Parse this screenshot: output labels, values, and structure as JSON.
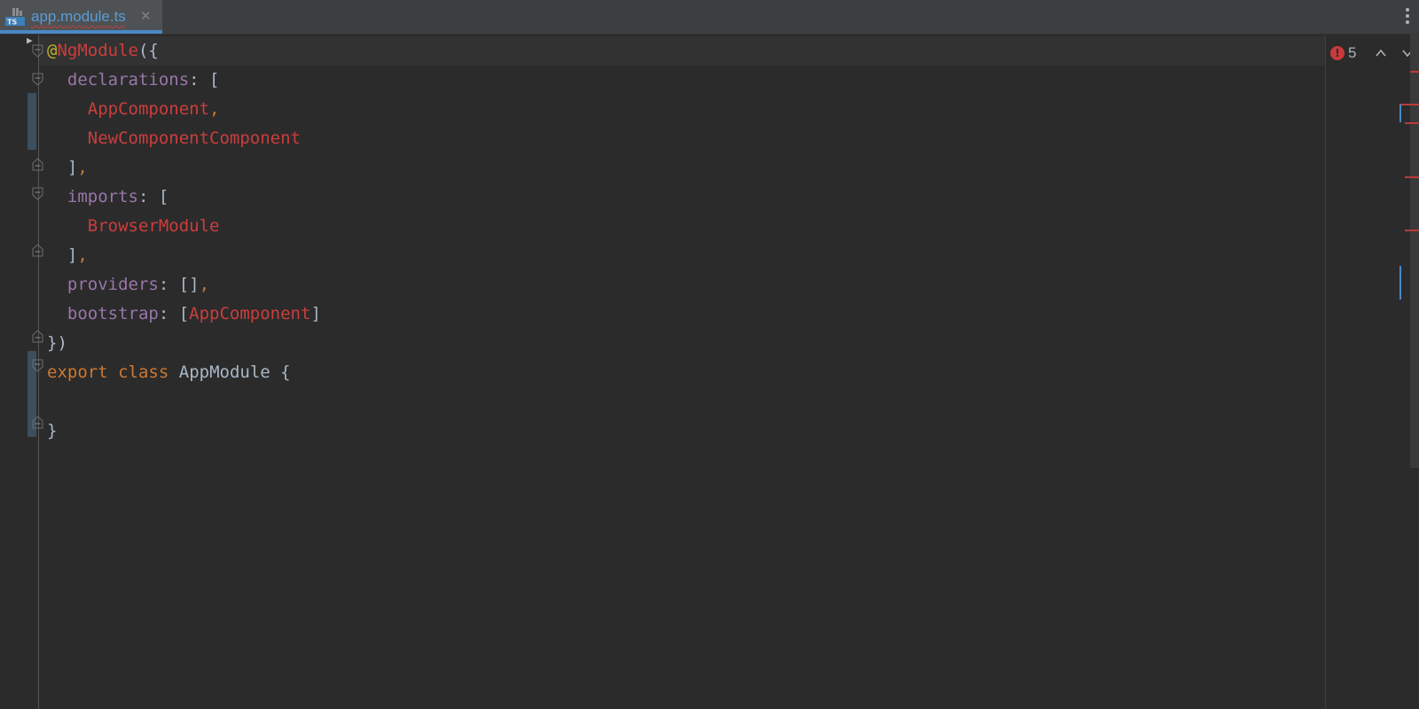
{
  "tab": {
    "filename": "app.module.ts",
    "icon": "typescript-file-icon",
    "icon_text": "TS",
    "close_glyph": "✕"
  },
  "inspection": {
    "error_count": "5"
  },
  "code": {
    "l1": {
      "at": "@",
      "decorator": "NgModule",
      "open": "({"
    },
    "l2": {
      "key": "declarations",
      "rest": ": ["
    },
    "l3": {
      "name": "AppComponent",
      "comma": ","
    },
    "l4": {
      "name": "NewComponentComponent"
    },
    "l5": {
      "close": "]",
      "comma": ","
    },
    "l6": {
      "key": "imports",
      "rest": ": ["
    },
    "l7": {
      "name": "BrowserModule"
    },
    "l8": {
      "close": "]",
      "comma": ","
    },
    "l9": {
      "key": "providers",
      "rest": ": []",
      "comma": ","
    },
    "l10": {
      "key": "bootstrap",
      "rest": ": [",
      "name": "AppComponent",
      "end": "]"
    },
    "l11": {
      "text": "})"
    },
    "l12": {
      "kw1": "export",
      "kw2": "class",
      "cls": "AppModule",
      "open": "{"
    },
    "l14": {
      "text": "}"
    }
  },
  "colors": {
    "background": "#2b2b2b",
    "keyword": "#cc7832",
    "property": "#9876aa",
    "error": "#cc3d3d",
    "annotation": "#bbb529",
    "text": "#a9b7c6",
    "tab_accent": "#4a88c7"
  }
}
